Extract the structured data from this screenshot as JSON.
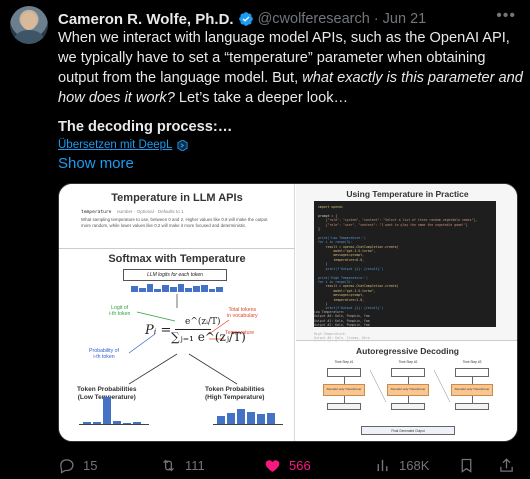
{
  "author": {
    "name": "Cameron R. Wolfe, Ph.D.",
    "handle": "@cwolferesearch",
    "separator": "·",
    "date": "Jun 21"
  },
  "tweet": {
    "text_part1": "When we interact with language model APIs, such as the OpenAI API, we typically have to set a “temperature” parameter when obtaining output from the language model. But, ",
    "text_italic": "what exactly is this parameter and how does it work?",
    "text_part2": " Let’s take a deeper look…",
    "section_heading": "The decoding process:…",
    "translate_label": "Übersetzen mit DeepL",
    "show_more": "Show more"
  },
  "media": {
    "left_panel": {
      "title": "Temperature in LLM APIs",
      "param_name": "temperature",
      "param_meta": "number · Optional · Defaults to 1",
      "param_desc": "What sampling temperature to use, between 0 and 2. Higher values like 0.8 will make the output more random, while lower values like 0.2 will make it more focused and deterministic.",
      "softmax_title": "Softmax with Temperature",
      "logits_label": "LLM logits for each token",
      "formula_p": "Pᵢ =",
      "formula_num": "e^(zᵢ/T)",
      "formula_den": "∑ⱼ₌₁ e^(zⱼ/T)",
      "ann_logit": "Logit of\ni-th token",
      "ann_prob": "Probability of\ni-th token",
      "ann_total": "Total tokens\nin vocabulary",
      "ann_temp": "Temperature",
      "low_label": "Token Probabilities\n(Low Temperature)",
      "high_label": "Token Probabilities\n(High Temperature)",
      "low_values": [
        0.06,
        0.07,
        1.0,
        0.1,
        0.05,
        0.06
      ],
      "high_values": [
        0.3,
        0.4,
        0.55,
        0.45,
        0.38,
        0.42
      ]
    },
    "right_top": {
      "title": "Using Temperature in Practice",
      "code_lines": [
        "import openai",
        "",
        "prompt = [",
        "    {\"role\": \"system\", \"content\": \"Select a list of three random vegetable names\"},",
        "    {\"role\": \"user\", \"content\": \"I want to play the name the vegetable game!\"}",
        "]",
        "",
        "print('Low Temperature:')",
        "for i in range(3):",
        "    result = openai.ChatCompletion.create(",
        "        model=\"gpt-3.5-turbo\",",
        "        messages=prompt,",
        "        temperature=0.0,",
        "    )",
        "    print(f'Output {i}: {result}')",
        "",
        "print('High Temperature:')",
        "for i in range(3):",
        "    result = openai.ChatCompletion.create(",
        "        model=\"gpt-3.5-turbo\",",
        "        messages=prompt,",
        "        temperature=1.0,",
        "    )",
        "    print(f'Output {i}: {result}')"
      ],
      "output_lines": [
        "Low Temperature:",
        "Output #0: Kale, Pumpkin, Yam",
        "Output #1: Kale, Pumpkin, Yam",
        "Output #2: Kale, Pumpkin, Yam",
        "",
        "High Temperature:",
        "Output #0: Kale, Jicama, Okra",
        "Output #1: Beet, Radish, Leek",
        "Output #2: Kohlrabi, Squash, Yam"
      ]
    },
    "right_bottom": {
      "title": "Autoregressive Decoding",
      "steps": [
        {
          "label": "Time Step #1",
          "llm": "Decoder-only Transformer"
        },
        {
          "label": "Time Step #2",
          "llm": "Decoder-only Transformer"
        },
        {
          "label": "Time Step #3",
          "llm": "Decoder-only Transformer"
        }
      ],
      "final_output": "Final Generated Output"
    }
  },
  "actions": {
    "replies": "15",
    "retweets": "111",
    "likes": "566",
    "views": "168K"
  },
  "colors": {
    "accent": "#1d9bf0",
    "like": "#f91880",
    "muted": "#71767b",
    "text": "#e7e9ea",
    "background": "#000000"
  },
  "icons": [
    "verified-badge-icon",
    "more-icon",
    "translate-icon",
    "reply-icon",
    "retweet-icon",
    "like-icon",
    "views-icon",
    "bookmark-icon",
    "share-icon"
  ]
}
